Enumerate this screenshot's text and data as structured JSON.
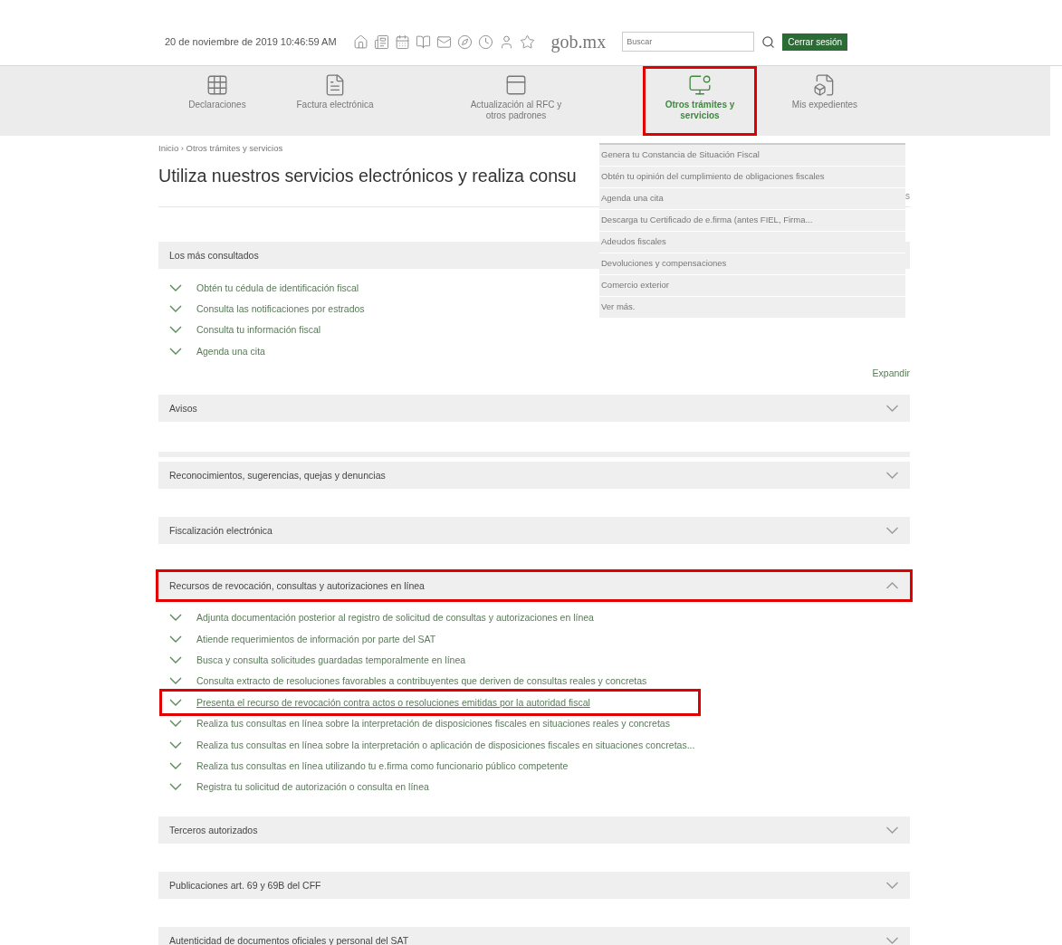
{
  "header": {
    "datetime": "20 de noviembre de 2019 10:46:59 AM",
    "logo": "gob.mx",
    "search": {
      "placeholder": "Buscar"
    },
    "logout": "Cerrar sesión"
  },
  "nav": {
    "items": [
      {
        "kind": "grid",
        "label": "Declaraciones",
        "selected": false,
        "highlighted": false
      },
      {
        "kind": "invoice",
        "label": "Factura electrónica",
        "selected": false,
        "highlighted": false
      },
      {
        "kind": "form",
        "label": "Actualización al RFC y otros padrones",
        "selected": false,
        "highlighted": false
      },
      {
        "kind": "monitor",
        "label": "Otros trámites y servicios",
        "selected": true,
        "highlighted": true
      },
      {
        "kind": "folder",
        "label": "Mis expedientes",
        "selected": false,
        "highlighted": false
      }
    ]
  },
  "dropdown": {
    "items": [
      "Genera tu Constancia de Situación Fiscal",
      "Obtén tu opinión del cumplimiento de obligaciones fiscales",
      "Agenda una cita",
      "Descarga tu Certificado de e.firma (antes FIEL, Firma...",
      "Adeudos fiscales",
      "Devoluciones y compensaciones",
      "Comercio exterior",
      "Ver más."
    ]
  },
  "breadcrumb": "Inicio › Otros trámites y servicios",
  "heading": "Utiliza nuestros servicios electrónicos y realiza consu",
  "heading_tail": "s",
  "expand_link": "Expandir",
  "sections": [
    {
      "title": "Los más consultados",
      "expanded": true,
      "highlighted": false,
      "items": [
        {
          "label": "Obtén tu cédula de identificación fiscal",
          "underlined": false,
          "highlighted": false
        },
        {
          "label": "Consulta las notificaciones por estrados",
          "underlined": false,
          "highlighted": false
        },
        {
          "label": "Consulta tu información fiscal",
          "underlined": false,
          "highlighted": false
        },
        {
          "label": "Agenda una cita",
          "underlined": false,
          "highlighted": false
        }
      ]
    },
    {
      "title": "Avisos",
      "expanded": false,
      "highlighted": false
    },
    {
      "title": "Reconocimientos, sugerencias, quejas y denuncias",
      "expanded": false,
      "highlighted": false
    },
    {
      "title": "Fiscalización electrónica",
      "expanded": false,
      "highlighted": false
    },
    {
      "title": "Recursos de revocación, consultas y autorizaciones en línea",
      "expanded": true,
      "highlighted": true,
      "items": [
        {
          "label": "Adjunta documentación posterior al registro de solicitud de consultas y autorizaciones en línea",
          "underlined": false,
          "highlighted": false
        },
        {
          "label": "Atiende requerimientos de información por parte del SAT",
          "underlined": false,
          "highlighted": false
        },
        {
          "label": "Busca y consulta solicitudes guardadas temporalmente en línea",
          "underlined": false,
          "highlighted": false
        },
        {
          "label": "Consulta extracto de resoluciones favorables a contribuyentes que deriven de consultas reales y concretas",
          "underlined": false,
          "highlighted": false
        },
        {
          "label": "Presenta el recurso de revocación contra actos o resoluciones emitidas por la autoridad fiscal",
          "underlined": true,
          "highlighted": true
        },
        {
          "label": "Realiza tus consultas en línea sobre la interpretación de disposiciones fiscales en situaciones reales y concretas",
          "underlined": false,
          "highlighted": false
        },
        {
          "label": "Realiza tus consultas en línea sobre la interpretación o aplicación de disposiciones fiscales en situaciones concretas...",
          "underlined": false,
          "highlighted": false
        },
        {
          "label": "Realiza tus consultas en línea utilizando tu e.firma como funcionario público competente",
          "underlined": false,
          "highlighted": false
        },
        {
          "label": "Registra tu solicitud de autorización o consulta en línea",
          "underlined": false,
          "highlighted": false
        }
      ]
    },
    {
      "title": "Terceros autorizados",
      "expanded": false,
      "highlighted": false
    },
    {
      "title": "Publicaciones art. 69 y 69B del CFF",
      "expanded": false,
      "highlighted": false
    },
    {
      "title": "Autenticidad de documentos oficiales y personal del SAT",
      "expanded": false,
      "highlighted": false
    }
  ]
}
